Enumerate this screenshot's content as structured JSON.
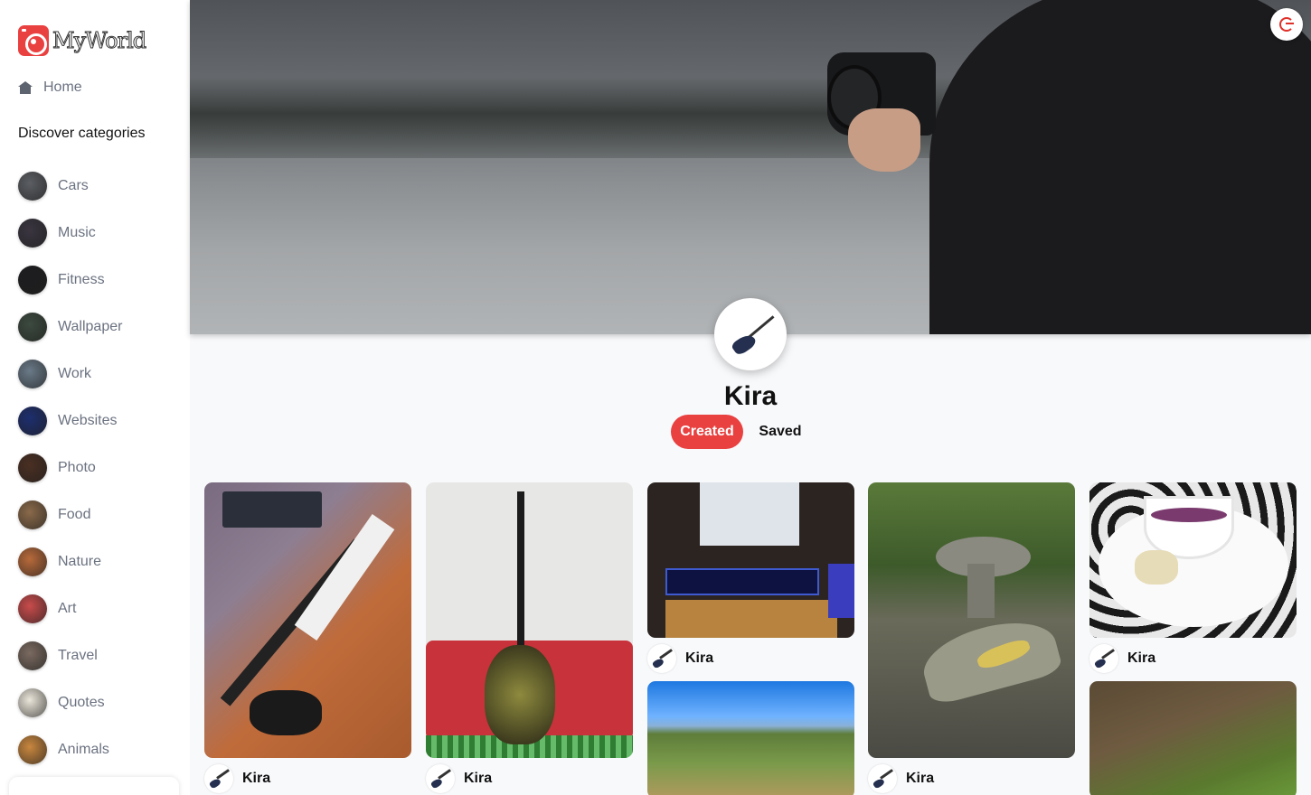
{
  "app": {
    "name": "MyWorld"
  },
  "sidebar": {
    "home_label": "Home",
    "categories_heading": "Discover categories",
    "categories": [
      {
        "label": "Cars",
        "color": "#5b5e63"
      },
      {
        "label": "Music",
        "color": "#3a3540"
      },
      {
        "label": "Fitness",
        "color": "#1d1d1f"
      },
      {
        "label": "Wallpaper",
        "color": "#3c4a3f"
      },
      {
        "label": "Work",
        "color": "#6a7a88"
      },
      {
        "label": "Websites",
        "color": "#1d2e6e"
      },
      {
        "label": "Photo",
        "color": "#4a2f22"
      },
      {
        "label": "Food",
        "color": "#8a6a4a"
      },
      {
        "label": "Nature",
        "color": "#b86a3a"
      },
      {
        "label": "Art",
        "color": "#c94b4b"
      },
      {
        "label": "Travel",
        "color": "#7a6a60"
      },
      {
        "label": "Quotes",
        "color": "#ebe6da"
      },
      {
        "label": "Animals",
        "color": "#c9873e"
      }
    ]
  },
  "profile": {
    "username": "Kira",
    "tabs": {
      "created": "Created",
      "saved": "Saved"
    },
    "accent": "#e94040"
  },
  "pins": [
    {
      "author": "Kira",
      "subject": "jackson-guitar-room"
    },
    {
      "author": "Kira",
      "subject": "guitar-on-red-sofa"
    },
    {
      "author": "Kira",
      "subject": "desk-setup"
    },
    {
      "author": "",
      "subject": "hill-landscape"
    },
    {
      "author": "Kira",
      "subject": "stone-table-garden"
    },
    {
      "author": "Kira",
      "subject": "soup-bowl"
    },
    {
      "author": "",
      "subject": "forest-floor"
    }
  ]
}
